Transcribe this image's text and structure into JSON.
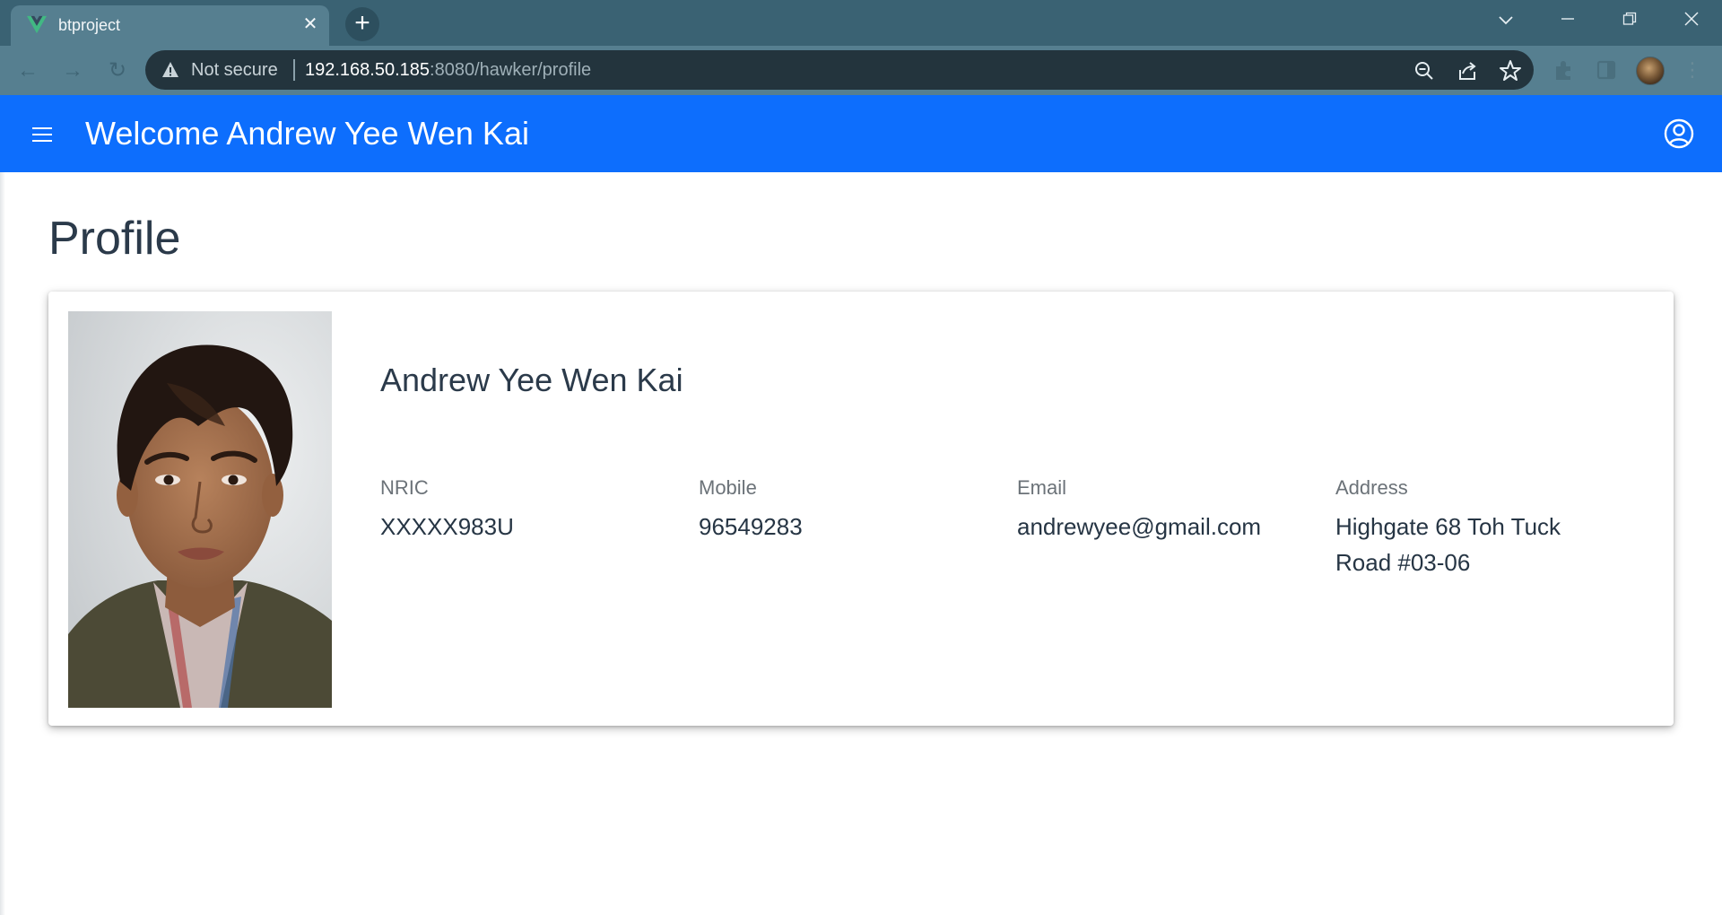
{
  "browser": {
    "tab_title": "btproject",
    "security_label": "Not secure",
    "url_host": "192.168.50.185",
    "url_rest": ":8080/hawker/profile"
  },
  "header": {
    "title": "Welcome Andrew Yee Wen Kai"
  },
  "page": {
    "title": "Profile"
  },
  "profile": {
    "name": "Andrew Yee Wen Kai",
    "fields": [
      {
        "label": "NRIC",
        "value": "XXXXX983U"
      },
      {
        "label": "Mobile",
        "value": "96549283"
      },
      {
        "label": "Email",
        "value": "andrewyee@gmail.com"
      },
      {
        "label": "Address",
        "value": "Highgate 68 Toh Tuck Road #03-06"
      }
    ]
  },
  "colors": {
    "header_blue": "#0d6efd",
    "tabstrip": "#3a6273",
    "toolbar": "#567f90",
    "text_dark": "#2b3a4a",
    "label_gray": "#6b7278"
  },
  "icons": {
    "favicon": "vue-logo-icon",
    "security": "warning-triangle-icon",
    "menu": "hamburger-menu-icon",
    "account": "account-circle-icon"
  }
}
